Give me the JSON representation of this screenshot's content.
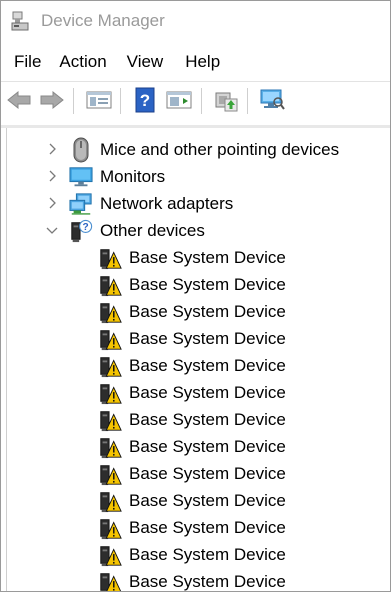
{
  "window": {
    "title": "Device Manager"
  },
  "menu": [
    "File",
    "Action",
    "View",
    "Help"
  ],
  "toolbar": {
    "buttons": [
      "back-icon",
      "forward-icon",
      "properties-icon",
      "help-icon",
      "console-tree-icon",
      "update-driver-icon",
      "scan-hardware-icon"
    ]
  },
  "tree": {
    "categories": [
      {
        "label": "Mice and other pointing devices",
        "icon": "mouse-icon",
        "expanded": false
      },
      {
        "label": "Monitors",
        "icon": "monitor-icon",
        "expanded": false
      },
      {
        "label": "Network adapters",
        "icon": "network-adapter-icon",
        "expanded": false
      },
      {
        "label": "Other devices",
        "icon": "unknown-device-icon",
        "expanded": true
      }
    ],
    "other_devices": [
      "Base System Device",
      "Base System Device",
      "Base System Device",
      "Base System Device",
      "Base System Device",
      "Base System Device",
      "Base System Device",
      "Base System Device",
      "Base System Device",
      "Base System Device",
      "Base System Device",
      "Base System Device",
      "Base System Device"
    ]
  }
}
